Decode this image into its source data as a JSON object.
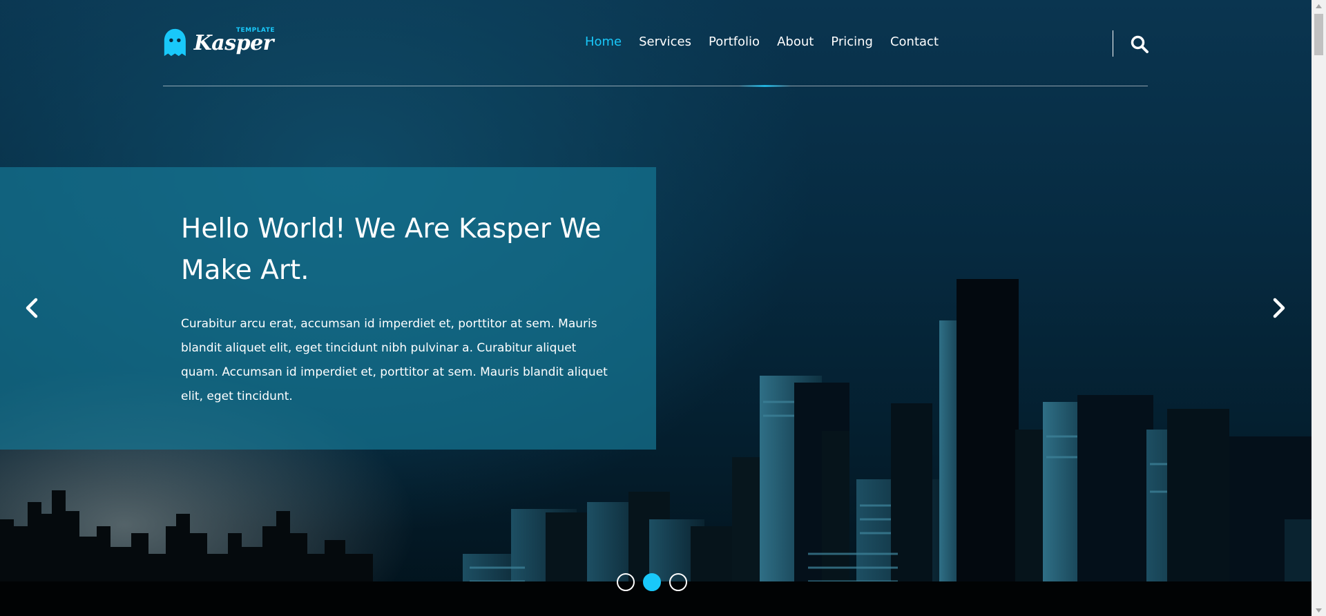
{
  "brand": {
    "name": "Kasper",
    "tag": "TEMPLATE",
    "accent_color": "#19c8fa"
  },
  "nav": {
    "items": [
      {
        "label": "Home",
        "active": true
      },
      {
        "label": "Services",
        "active": false
      },
      {
        "label": "Portfolio",
        "active": false
      },
      {
        "label": "About",
        "active": false
      },
      {
        "label": "Pricing",
        "active": false
      },
      {
        "label": "Contact",
        "active": false
      }
    ],
    "search_icon": "search-icon"
  },
  "slide": {
    "title": "Hello World! We Are Kasper We Make Art.",
    "text": "Curabitur arcu erat, accumsan id imperdiet et, porttitor at sem. Mauris blandit aliquet elit, eget tincidunt nibh pulvinar a. Curabitur aliquet quam. Accumsan id imperdiet et, porttitor at sem. Mauris blandit aliquet elit, eget tincidunt.",
    "prev_icon": "chevron-left-icon",
    "next_icon": "chevron-right-icon",
    "bullets_total": 3,
    "bullets_active": 2
  },
  "colors": {
    "slide_box": "#157591",
    "background": "#062a40"
  }
}
